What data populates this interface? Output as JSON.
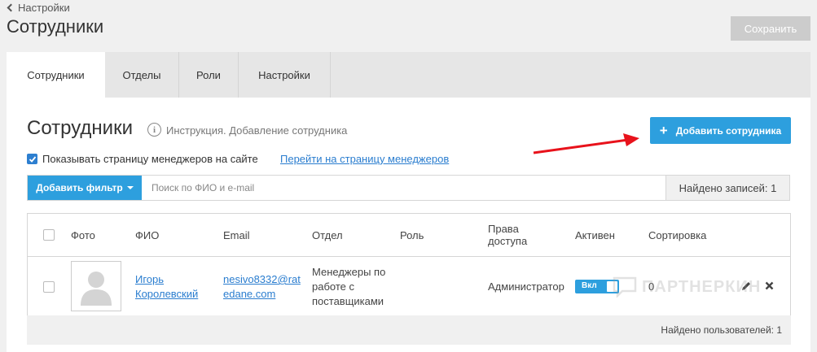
{
  "header": {
    "back_label": "Настройки",
    "title": "Сотрудники",
    "save_label": "Сохранить"
  },
  "tabs": [
    {
      "label": "Сотрудники",
      "active": true
    },
    {
      "label": "Отделы",
      "active": false
    },
    {
      "label": "Роли",
      "active": false
    },
    {
      "label": "Настройки",
      "active": false
    }
  ],
  "section": {
    "title": "Сотрудники",
    "instruction_link": "Инструкция. Добавление сотрудника",
    "add_employee_label": "Добавить сотрудника",
    "show_managers_label": "Показывать страницу менеджеров на сайте",
    "show_managers_checked": true,
    "managers_page_link": "Перейти на страницу менеджеров"
  },
  "filter": {
    "add_filter_label": "Добавить фильтр",
    "search_placeholder": "Поиск по ФИО и e-mail",
    "found_records": "Найдено записей: 1"
  },
  "table": {
    "columns": [
      "Фото",
      "ФИО",
      "Email",
      "Отдел",
      "Роль",
      "Права доступа",
      "Активен",
      "Сортировка"
    ],
    "rows": [
      {
        "name": "Игорь Королевский",
        "email": "nesivo8332@ratedane.com",
        "department": "Менеджеры по работе с поставщиками",
        "role": "",
        "access": "Администратор",
        "active_label": "Вкл",
        "active": true,
        "sort": "0"
      }
    ],
    "found_users": "Найдено пользователей: 1"
  },
  "watermark": "ПАРТНЕРКИН",
  "colors": {
    "accent": "#2d9fde",
    "link": "#2a7dcf",
    "arrow": "#e8121b",
    "save_disabled": "#cccccc"
  }
}
